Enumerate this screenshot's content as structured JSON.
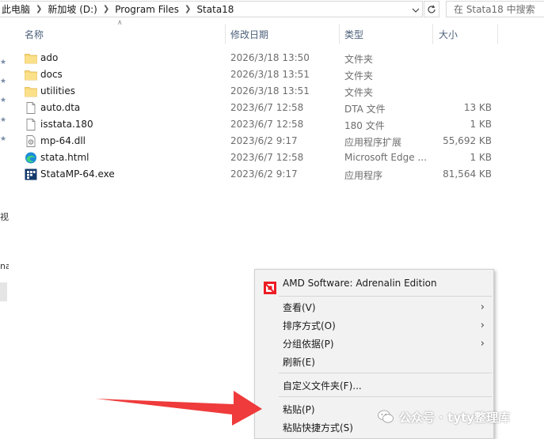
{
  "address": {
    "breadcrumbs": [
      "此电脑",
      "新加坡 (D:)",
      "Program Files",
      "Stata18"
    ],
    "dropdown_icon": "chevron-down-icon",
    "refresh_icon": "refresh-icon",
    "search_placeholder": "在 Stata18 中搜索"
  },
  "columns": {
    "name": "名称",
    "date": "修改日期",
    "type": "类型",
    "size": "大小"
  },
  "files": [
    {
      "name": "ado",
      "date": "2026/3/18 13:50",
      "type": "文件夹",
      "size": "",
      "icon": "folder-icon"
    },
    {
      "name": "docs",
      "date": "2026/3/18 13:51",
      "type": "文件夹",
      "size": "",
      "icon": "folder-icon"
    },
    {
      "name": "utilities",
      "date": "2026/3/18 13:51",
      "type": "文件夹",
      "size": "",
      "icon": "folder-icon"
    },
    {
      "name": "auto.dta",
      "date": "2023/6/7 12:58",
      "type": "DTA 文件",
      "size": "13 KB",
      "icon": "file-icon"
    },
    {
      "name": "isstata.180",
      "date": "2023/6/7 12:58",
      "type": "180 文件",
      "size": "1 KB",
      "icon": "text-file-icon"
    },
    {
      "name": "mp-64.dll",
      "date": "2023/6/2 9:17",
      "type": "应用程序扩展",
      "size": "55,692 KB",
      "icon": "dll-file-icon"
    },
    {
      "name": "stata.html",
      "date": "2023/6/7 12:58",
      "type": "Microsoft Edge ...",
      "size": "1 KB",
      "icon": "edge-icon"
    },
    {
      "name": "StataMP-64.exe",
      "date": "2023/6/2 9:17",
      "type": "应用程序",
      "size": "81,564 KB",
      "icon": "stata-exe-icon"
    }
  ],
  "left_edge": {
    "fragments": [
      "视",
      "na"
    ]
  },
  "context_menu": {
    "header": "AMD Software: Adrenalin Edition",
    "items": [
      {
        "label": "查看(V)",
        "submenu": true
      },
      {
        "label": "排序方式(O)",
        "submenu": true
      },
      {
        "label": "分组依据(P)",
        "submenu": true
      },
      {
        "label": "刷新(E)",
        "submenu": false
      },
      {
        "label": "自定义文件夹(F)...",
        "submenu": false
      },
      {
        "label": "粘贴(P)",
        "submenu": false
      },
      {
        "label": "粘贴快捷方式(S)",
        "submenu": false
      }
    ],
    "accent_color": "#ed1c24"
  },
  "watermark": {
    "text": "公众号 · tyty整理库",
    "icon": "wechat-icon"
  },
  "annotation": {
    "arrow_color": "#ef3b3b",
    "icon": "red-arrow-pointer"
  }
}
